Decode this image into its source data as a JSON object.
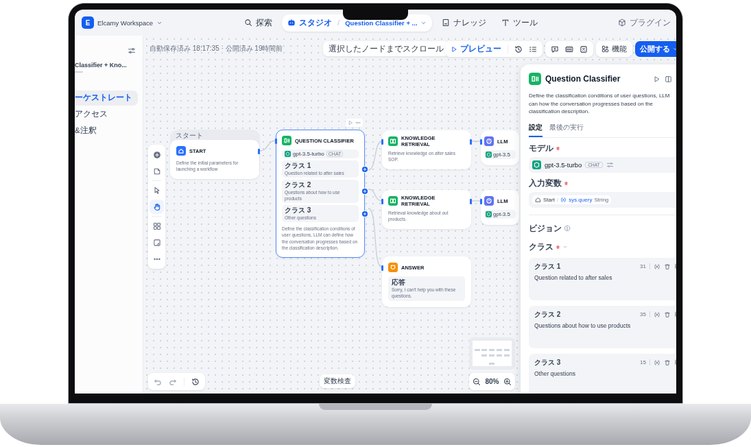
{
  "header": {
    "workspace": {
      "initial": "E",
      "name": "Elcamy Workspace"
    },
    "nav": [
      {
        "kind": "explore",
        "label": "探索",
        "selected": false
      },
      {
        "kind": "studio",
        "label": "スタジオ",
        "selected": true,
        "separator": "/",
        "app": "Question Classifier + ..."
      },
      {
        "kind": "knowledge",
        "label": "ナレッジ",
        "selected": false
      },
      {
        "kind": "tools",
        "label": "ツール",
        "selected": false
      },
      {
        "kind": "plugins",
        "label": "プラグイン",
        "selected": false
      }
    ]
  },
  "sidebar": {
    "app_title": "Classifier + Kno...",
    "items": [
      {
        "label": "ーケストレート",
        "selected": true
      },
      {
        "label": "アクセス",
        "selected": false
      },
      {
        "label": "&注釈",
        "selected": false
      }
    ]
  },
  "canvas": {
    "status": "自動保存済み 18:17:35 · 公開済み 19時間前",
    "scroll_button": "選択したノードまでスクロール",
    "preview_button": "プレビュー",
    "features_button": "機能",
    "publish_button": "公開する",
    "tools": [
      {
        "kind": "add",
        "selected": false
      },
      {
        "kind": "note",
        "selected": false
      },
      {
        "kind": "pointer",
        "selected": false
      },
      {
        "kind": "hand",
        "selected": true
      },
      {
        "kind": "organize",
        "selected": false
      },
      {
        "kind": "export",
        "selected": false
      },
      {
        "kind": "more",
        "selected": false
      }
    ],
    "nodes": [
      {
        "kind": "start",
        "group_label": "スタート",
        "title": "START",
        "description": "Define the initial parameters for launching a workflow",
        "selected": false
      },
      {
        "kind": "classifier",
        "title": "QUESTION CLASSIFIER",
        "model": "gpt-3.5-turbo",
        "mode": "CHAT",
        "classes": [
          {
            "label": "クラス 1",
            "text": "Question related to after sales"
          },
          {
            "label": "クラス 2",
            "text": "Questions about how to use products"
          },
          {
            "label": "クラス 3",
            "text": "Other questions"
          }
        ],
        "description": "Define the classification conditions of user questions, LLM can define how the conversation progresses based on the classification description.",
        "selected": true
      },
      {
        "kind": "retrieval",
        "title": "KNOWLEDGE RETRIEVAL",
        "description": "Retrieve knowledge on after sales SOP.",
        "selected": false
      },
      {
        "kind": "llm",
        "title": "LLM",
        "model": "gpt-3.5",
        "selected": false
      },
      {
        "kind": "retrieval",
        "title": "KNOWLEDGE RETRIEVAL",
        "description": "Retrieval knowledge about out products.",
        "selected": false
      },
      {
        "kind": "llm",
        "title": "LLM",
        "model": "gpt-3.5",
        "selected": false
      },
      {
        "kind": "answer",
        "title": "ANSWER",
        "reply_label": "応答",
        "reply": "Sorry, I can't help you with these questions.",
        "selected": false
      }
    ],
    "variable_inspect": "変数検査",
    "zoom": "80%"
  },
  "panel": {
    "title": "Question Classifier",
    "description": "Define the classification conditions of user questions, LLM can how the conversation progresses based on the classification description.",
    "tabs": [
      {
        "label": "設定",
        "selected": true
      },
      {
        "label": "最後の実行",
        "selected": false
      }
    ],
    "model_label": "モデル",
    "model_required": true,
    "model": {
      "name": "gpt-3.5-turbo",
      "mode": "CHAT"
    },
    "input_label": "入力変数",
    "input_required": true,
    "variable": {
      "node": "Start",
      "separator": "/",
      "name": "sys.query",
      "type": "String"
    },
    "vision_label": "ビジョン",
    "classes_label": "クラス",
    "classes_required": true,
    "classes": [
      {
        "label": "クラス 1",
        "count": "31",
        "text": "Question related to after sales"
      },
      {
        "label": "クラス 2",
        "count": "35",
        "text": "Questions about how to use products"
      },
      {
        "label": "クラス 3",
        "count": "15",
        "text": "Other questions"
      }
    ]
  }
}
